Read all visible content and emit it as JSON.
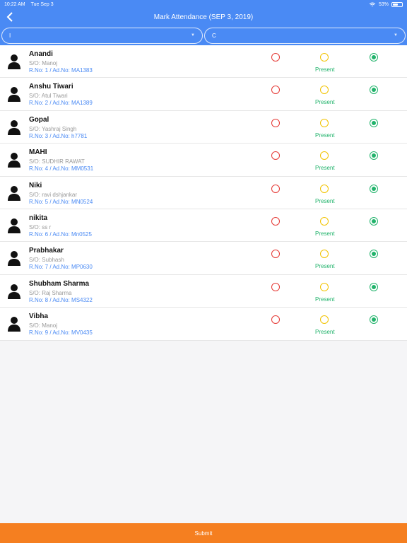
{
  "status": {
    "time": "10:22 AM",
    "date": "Tue Sep 3",
    "battery": "53%"
  },
  "header": {
    "title": "Mark Attendance (SEP 3, 2019)"
  },
  "filters": {
    "class_value": "I",
    "section_value": "C"
  },
  "students": [
    {
      "name": "Anandi",
      "parent": "S/O: Manoj",
      "ids": "R.No: 1 / Ad.No: MA1383",
      "status": "Present"
    },
    {
      "name": "Anshu Tiwari",
      "parent": "S/O: Atul Tiwari",
      "ids": "R.No: 2 / Ad.No: MA1389",
      "status": "Present"
    },
    {
      "name": "Gopal",
      "parent": "S/O: Yashraj Singh",
      "ids": "R.No: 3 / Ad.No: h7781",
      "status": "Present"
    },
    {
      "name": "MAHI",
      "parent": "S/O: SUDHIR RAWAT",
      "ids": "R.No: 4 / Ad.No: MM0531",
      "status": "Present"
    },
    {
      "name": "Niki",
      "parent": "S/O: ravi dshjankar",
      "ids": "R.No: 5 / Ad.No: MN0524",
      "status": "Present"
    },
    {
      "name": "nikita",
      "parent": "S/O: ss r",
      "ids": "R.No: 6 / Ad.No: Mn0525",
      "status": "Present"
    },
    {
      "name": "Prabhakar",
      "parent": "S/O: Subhash",
      "ids": "R.No: 7 / Ad.No: MP0630",
      "status": "Present"
    },
    {
      "name": "Shubham Sharma",
      "parent": "S/O: Raj Sharma",
      "ids": "R.No: 8 / Ad.No: MS4322",
      "status": "Present"
    },
    {
      "name": "Vibha",
      "parent": "S/O: Manoj",
      "ids": "R.No: 9 / Ad.No: MV0435",
      "status": "Present"
    }
  ],
  "footer": {
    "submit_label": "Submit"
  },
  "colors": {
    "header": "#4a8af4",
    "absent": "#e53935",
    "late": "#f2c300",
    "present": "#21b36b",
    "submit": "#f57f20"
  }
}
